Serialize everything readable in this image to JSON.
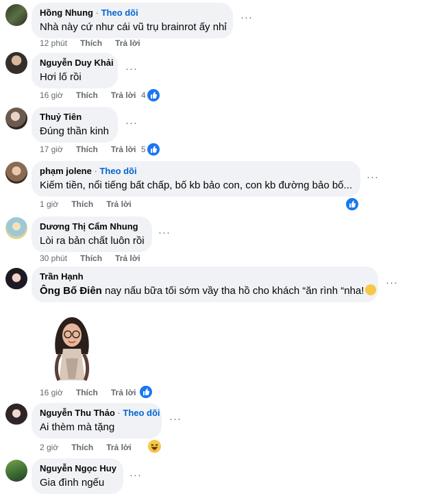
{
  "comments": [
    {
      "name": "Hồng Nhung",
      "follow": "Theo dõi",
      "text": "Nhà này cứ như cái vũ trụ brainrot ấy nhỉ",
      "time": "12 phút",
      "like": "Thích",
      "reply": "Trả lời"
    },
    {
      "name": "Nguyễn Duy Khải",
      "text": "Hơi lố rồi",
      "time": "16 giờ",
      "like": "Thích",
      "reply": "Trả lời",
      "reaction_count": "4"
    },
    {
      "name": "Thuỷ Tiên",
      "text": "Đúng thần kinh",
      "time": "17 giờ",
      "like": "Thích",
      "reply": "Trả lời",
      "reaction_count": "5"
    },
    {
      "name": "phạm jolene",
      "follow": "Theo dõi",
      "text": "Kiếm tiền, nổi tiếng bất chấp, bố kb bảo con, con kb đường bảo bố...",
      "time": "1 giờ",
      "like": "Thích",
      "reply": "Trả lời"
    },
    {
      "name": "Dương Thị Cẩm Nhung",
      "text": "Lòi ra bản chất luôn rồi",
      "time": "30 phút",
      "like": "Thích",
      "reply": "Trả lời"
    },
    {
      "name": "Trần Hạnh",
      "text_bold": "Ông Bố Điên",
      "text": "nay nấu bữa tối sớm vầy tha hồ cho khách “ăn rình “nha!",
      "time": "16 giờ",
      "like": "Thích",
      "reply": "Trả lời"
    },
    {
      "name": "Nguyễn Thu Thảo",
      "follow": "Theo dõi",
      "text": "Ai thèm mà tặng",
      "time": "2 giờ",
      "like": "Thích",
      "reply": "Trả lời"
    },
    {
      "name": "Nguyễn Ngọc Huy",
      "text": "Gia đình ngếu"
    }
  ],
  "more_label": "···",
  "dot": "·",
  "colors": {
    "like_blue": "#1877f2",
    "link_blue": "#0064d1",
    "bubble": "#f0f2f5",
    "meta": "#65676b"
  },
  "icons": {
    "like": "like-reaction-icon",
    "haha": "haha-reaction-icon",
    "more": "more-options-icon"
  }
}
